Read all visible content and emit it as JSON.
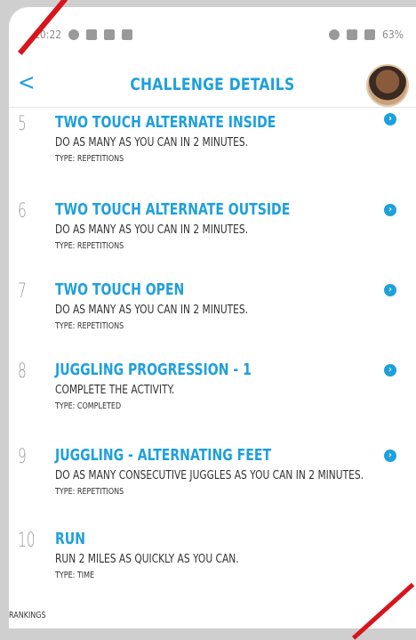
{
  "status_bar": {
    "time": "10:22",
    "battery": "63%"
  },
  "header": {
    "title": "CHALLENGE DETAILS",
    "back_label": "<"
  },
  "items": [
    {
      "number": "5",
      "name": "TWO TOUCH ALTERNATE INSIDE",
      "description": "DO AS MANY AS YOU CAN IN 2 MINUTES.",
      "type": "TYPE: REPETITIONS"
    },
    {
      "number": "6",
      "name": "TWO TOUCH ALTERNATE OUTSIDE",
      "description": "DO AS MANY AS YOU CAN IN 2 MINUTES.",
      "type": "TYPE: REPETITIONS"
    },
    {
      "number": "7",
      "name": "TWO TOUCH OPEN",
      "description": "DO AS MANY AS YOU CAN IN 2 MINUTES.",
      "type": "TYPE: REPETITIONS"
    },
    {
      "number": "8",
      "name": "JUGGLING PROGRESSION - 1",
      "description": "COMPLETE THE ACTIVITY.",
      "type": "TYPE: COMPLETED"
    },
    {
      "number": "9",
      "name": "JUGGLING - ALTERNATING FEET",
      "description": "DO AS MANY CONSECUTIVE JUGGLES AS YOU CAN IN 2 MINUTES.",
      "type": "TYPE: REPETITIONS"
    },
    {
      "number": "10",
      "name": "RUN",
      "description": "RUN 2 MILES AS QUICKLY AS YOU CAN.",
      "type": "TYPE: TIME"
    }
  ],
  "footer": {
    "rankings_label": "RANKINGS"
  },
  "colors": {
    "accent": "#1ea0dc",
    "annotation": "#d8141c"
  },
  "icons": {
    "back": "chevron-left-icon",
    "item_action": "chevron-right-circle-icon"
  }
}
